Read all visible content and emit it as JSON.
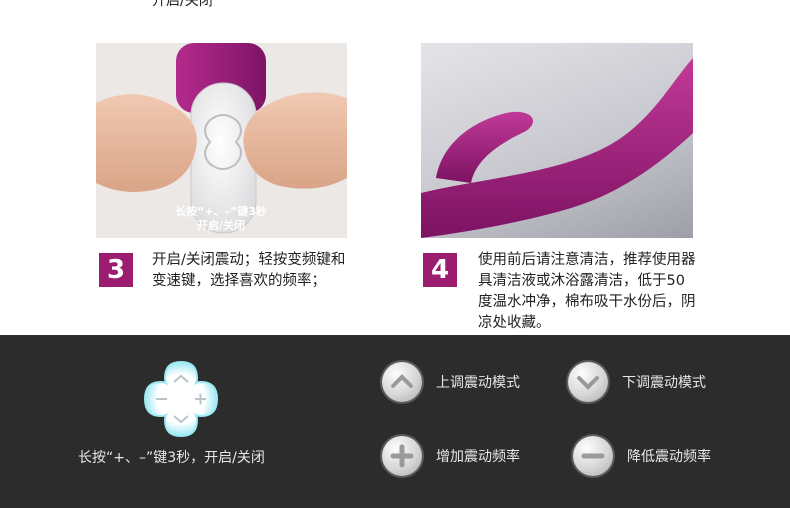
{
  "top_fragment": "开启/关闭",
  "photos": {
    "left": {
      "caption_line1": "长按“+、–”键3秒",
      "caption_line2": "开启/关闭"
    }
  },
  "steps": [
    {
      "number": "3",
      "text": "开启/关闭震动；轻按变频键和变速键，选择喜欢的频率；"
    },
    {
      "number": "4",
      "text": "使用前后请注意清洁，推荐使用器具清洁液或沐浴露清洁，低于50度温水冲净，棉布吸干水份后，阴凉处收藏。"
    }
  ],
  "legend": {
    "controller_caption": "长按“+、–”键3秒，开启/关闭",
    "items": [
      {
        "icon": "chevron-up-icon",
        "label": "上调震动模式"
      },
      {
        "icon": "chevron-down-icon",
        "label": "下调震动模式"
      },
      {
        "icon": "plus-icon",
        "label": "增加震动频率"
      },
      {
        "icon": "minus-icon",
        "label": "降低震动频率"
      }
    ]
  },
  "colors": {
    "badge": "#9c1c6f",
    "product_purple": "#a3217e",
    "legend_bg": "#2c2c2c",
    "controller_glow": "#7fe0ef"
  }
}
